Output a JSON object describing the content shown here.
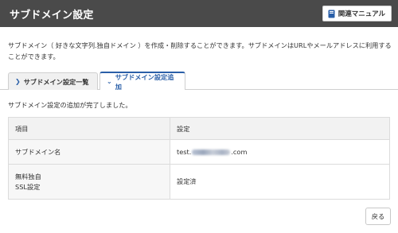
{
  "header": {
    "title": "サブドメイン設定",
    "manual_button": "関連マニュアル",
    "manual_icon": "book-icon"
  },
  "description": "サブドメイン（ 好きな文字列.独自ドメイン ）を作成・削除することができます。サブドメインはURLやメールアドレスに利用することができます。",
  "tabs": [
    {
      "label": "サブドメイン設定一覧",
      "icon": "chevron-right-icon",
      "active": false
    },
    {
      "label": "サブドメイン設定追加",
      "icon": "chevron-down-icon",
      "active": true
    }
  ],
  "message": "サブドメイン設定の追加が完了しました。",
  "table": {
    "headers": [
      "項目",
      "設定"
    ],
    "rows": [
      {
        "label": "サブドメイン名",
        "value_prefix": "test.",
        "value_suffix": ".com",
        "value_blurred": true
      },
      {
        "label_line1": "無料独自",
        "label_line2": "SSL設定",
        "value": "設定済"
      }
    ]
  },
  "back_button": "戻る",
  "colors": {
    "header_bg": "#4a4a4a",
    "accent": "#2a5fa8",
    "manual_icon": "#2a5fa8"
  }
}
